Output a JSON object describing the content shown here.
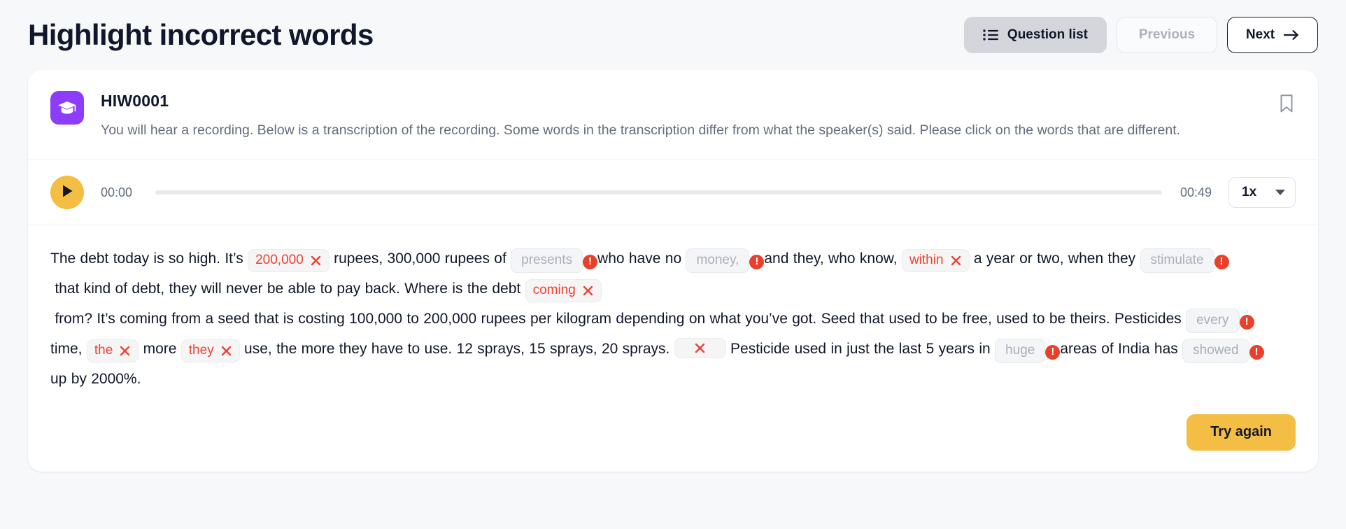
{
  "header": {
    "title": "Highlight incorrect words",
    "question_list_label": "Question list",
    "previous_label": "Previous",
    "next_label": "Next"
  },
  "question": {
    "code": "HIW0001",
    "description": "You will hear a recording. Below is a transcription of the recording. Some words in the transcription differ from what the speaker(s) said. Please click on the words that are different."
  },
  "player": {
    "current_time": "00:00",
    "duration": "00:49",
    "speed": "1x",
    "progress_percent": 0
  },
  "transcript": {
    "tokens": [
      {
        "type": "text",
        "value": "The debt today is so high. It’s "
      },
      {
        "type": "wrong",
        "value": "200,000"
      },
      {
        "type": "text",
        "value": " rupees, 300,000 rupees of "
      },
      {
        "type": "gray",
        "value": "presents"
      },
      {
        "type": "bang",
        "value": "!"
      },
      {
        "type": "text",
        "value": "who have no "
      },
      {
        "type": "gray",
        "value": "money,"
      },
      {
        "type": "bang",
        "value": "!"
      },
      {
        "type": "text",
        "value": "and they, who know, "
      },
      {
        "type": "wrong",
        "value": "within"
      },
      {
        "type": "text",
        "value": " a year or two, when they "
      },
      {
        "type": "gray",
        "value": "stimulate"
      },
      {
        "type": "bang",
        "value": "!"
      },
      {
        "type": "text",
        "value": " that kind of debt, they will never be able to pay back. Where is the debt "
      },
      {
        "type": "wrong",
        "value": "coming"
      },
      {
        "type": "text",
        "value": " from? It’s coming from a seed that is costing 100,000 to 200,000 rupees per kilogram depending on what you’ve got. Seed that used to be free, used to be theirs. Pesticides "
      },
      {
        "type": "gray",
        "value": "every"
      },
      {
        "type": "bang",
        "value": "!"
      },
      {
        "type": "text",
        "value": "time, "
      },
      {
        "type": "wrong",
        "value": "the"
      },
      {
        "type": "text",
        "value": " more "
      },
      {
        "type": "wrong",
        "value": "they"
      },
      {
        "type": "text",
        "value": " use, the more they have to use. 12 sprays, 15 sprays, 20 sprays. "
      },
      {
        "type": "empty",
        "value": ""
      },
      {
        "type": "text",
        "value": " Pesticide used in just the last 5 years in "
      },
      {
        "type": "gray",
        "value": "huge"
      },
      {
        "type": "bang",
        "value": "!"
      },
      {
        "type": "text",
        "value": "areas of India has "
      },
      {
        "type": "gray",
        "value": "showed"
      },
      {
        "type": "bang",
        "value": "!"
      },
      {
        "type": "text",
        "value": "up by 2000%."
      }
    ]
  },
  "footer": {
    "try_again_label": "Try again"
  },
  "colors": {
    "accent_yellow": "#f4bd44",
    "brand_purple": "#8b3dfa",
    "error_red": "#e8402a",
    "wrong_text": "#ef4130",
    "page_bg": "#f7f8fa",
    "title": "#11172b"
  },
  "icons": {
    "question_list": "list-icon",
    "next": "arrow-right-icon",
    "bookmark": "bookmark-icon",
    "badge": "graduation-cap-icon",
    "play": "play-icon",
    "speed_caret": "chevron-down-icon",
    "chip_remove": "x-icon",
    "error_badge": "exclamation-circle-icon"
  }
}
